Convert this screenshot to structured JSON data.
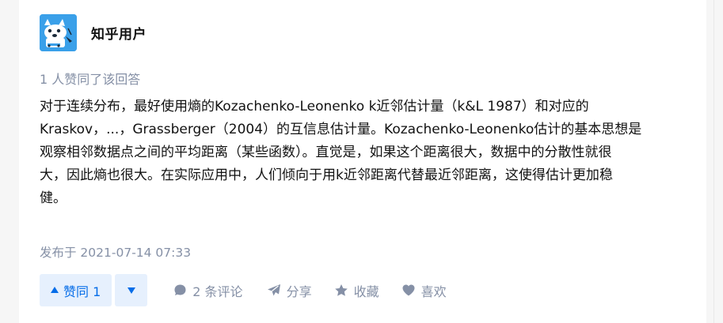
{
  "author": {
    "name": "知乎用户",
    "avatar_icon": "husky-dog-avatar-icon",
    "avatar_color": "#3aa0e9"
  },
  "vote_info": "1 人赞同了该回答",
  "content": {
    "lines": [
      "对于连续分布，最好使用熵的Kozachenko-Leonenko k近邻估计量（k&L 1987）和对应的",
      "Kraskov，...，Grassberger（2004）的互信息估计量。Kozachenko-Leonenko估计的基本思想是",
      "观察相邻数据点之间的平均距离（某些函数）。直觉是，如果这个距离很大，数据中的分散性就很",
      "大，因此熵也很大。在实际应用中，人们倾向于用k近邻距离代替最近邻距离，这使得估计更加稳",
      "健。"
    ]
  },
  "publish_time": "发布于 2021-07-14 07:33",
  "actions": {
    "vote_up_label": "赞同 1",
    "comment_label": "2 条评论",
    "share_label": "分享",
    "favorite_label": "收藏",
    "like_label": "喜欢"
  },
  "colors": {
    "accent": "#056de8",
    "accent_bg": "#e6f0fd",
    "meta_text": "#8590a6",
    "body_text": "#121212"
  },
  "icons": {
    "vote_up": "triangle-up-icon",
    "vote_down": "triangle-down-icon",
    "comment": "comment-bubble-icon",
    "share": "paper-plane-icon",
    "favorite": "star-icon",
    "like": "heart-icon"
  }
}
